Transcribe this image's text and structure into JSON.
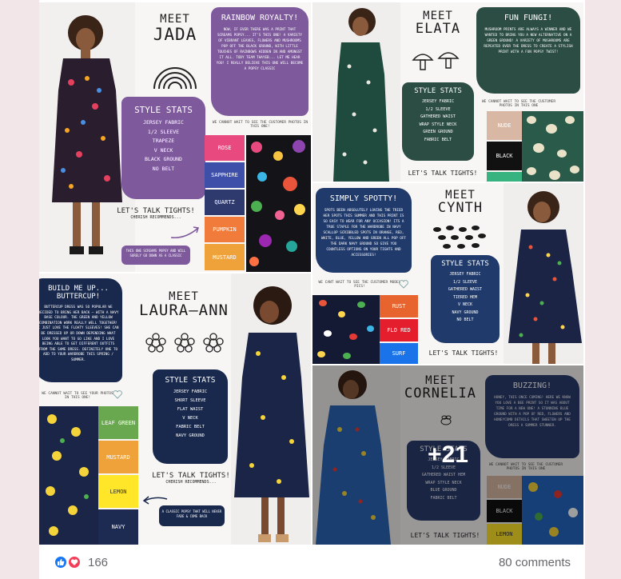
{
  "post": {
    "photo_count_overlay": "+21",
    "reactions": {
      "count": "166",
      "like_icon": "thumbs-up-icon",
      "love_icon": "heart-icon",
      "like_color": "#1877f2",
      "love_color": "#f33e58"
    },
    "comments_label": "80 comments"
  },
  "tiles": {
    "jada": {
      "meet": "MEET",
      "name": "JADA",
      "panel_title": "RAINBOW ROYALTY!",
      "panel_body": "NOW, IF EVER THERE WAS A PRINT THAT SCREAMS POPSY... IT'S THIS ONE! A VARIETY OF VIBRANT LEAVES, FLOWERS AND MUSHROOMS POP OFF THE BLACK GROUND, WITH LITTLE TOUCHES OF RAINBOWS HIDDEN IN AND AMONGST IT ALL. TODY TEAM THAYEB... LET ME HEAR YOU! I REALLY BELIEVE THIS ONE WILL BECOME A POPSY CLASSIC",
      "stats_title": "STYLE STATS",
      "stats": [
        "JERSEY FABRIC",
        "1/2 SLEEVE",
        "TRAPEZE",
        "V NECK",
        "BLACK GROUND",
        "NO BELT"
      ],
      "customer_caption": "WE CANNOT WAIT TO SEE THE CUSTOMER PHOTOS IN THIS ONE!",
      "tights_title": "LET'S TALK TIGHTS!",
      "tights_sub": "CHERISH RECOMMENDS...",
      "tights_note": "THIS ONE SCREAMS POPSY AND WILL SURELY GO DOWN AS A CLASSIC",
      "swatches": [
        "ROSE",
        "SAPPHIRE",
        "QUARTZ",
        "PUMPKIN",
        "MUSTARD"
      ],
      "panel_color": "#7e5a9c"
    },
    "elata": {
      "meet": "MEET",
      "name": "ELATA",
      "panel_title": "FUN FUNGI!",
      "panel_body": "MUSHROOM PRINTS ARE ALWAYS A WINNER AND WE WANTED TO BRING YOU A NEW ALTERNATIVE ON A GREEN GROUND! A VARIETY OF MUSHROOMS ARE REPEATED OVER THE DRESS TO CREATE A STYLISH PRINT WITH A FUN POPSY TWIST!",
      "stats_title": "STYLE STATS",
      "stats": [
        "JERSEY FABRIC",
        "1/2 SLEEVE",
        "GATHERED WAIST",
        "WRAP STYLE NECK",
        "GREEN GROUND",
        "FABRIC BELT"
      ],
      "customer_caption": "WE CANNOT WAIT TO SEE THE CUSTOMER PHOTOS IN THIS ONE",
      "tights_title": "LET'S TALK TIGHTS!",
      "swatches": [
        "NUDE",
        "BLACK"
      ],
      "panel_color": "#2c4d44"
    },
    "cynth": {
      "meet": "MEET",
      "name": "CYNTH",
      "panel_title": "SIMPLY SPOTTY!",
      "panel_body": "SPOTS BEEN ABSOLUTELY LOVING THE TRIED HER SPOTS THIS SUMMER AND THIS PRINT IS SO EASY TO WEAR FOR ANY OCCASION! ITS A TRUE STAPLE FOR THE WARDROBE IN NAVY SCALLOP SCRIBBLED SPOTS IN ORANGE, RED, WHITE, BLUE, YELLOW AND GREEN ALL POP OFF THE DARK NAVY GROUND SO GIVE YOU COUNTLESS OPTIONS ON YOUR TIGHTS AND ACCESSORIES!",
      "customer_caption": "WE CANT WAIT TO SEE THE CUSTOMER MODEL PICS!",
      "stats_title": "STYLE STATS",
      "stats": [
        "JERSEY FABRIC",
        "1/2 SLEEVE",
        "GATHERED WAIST",
        "TIERED HEM",
        "V NECK",
        "NAVY GROUND",
        "NO BELT"
      ],
      "tights_title": "LET'S TALK TIGHTS!",
      "swatches": [
        "RUST",
        "FLO RED",
        "SURF"
      ],
      "panel_color": "#1f3a6b"
    },
    "laura": {
      "meet": "MEET",
      "name": "LAURA—ANN",
      "panel_title": "BUILD ME UP... BUTTERCUP!",
      "panel_body": "BUTTERCUP DRESS WAS SO POPULAR WE DECIDED TO BRING HER BACK — WITH A NAVY BASE COLOUR. THE GREEN AND YELLOW COMBINATION WORK REALLY WELL TOGETHER! I JUST LOVE THE FLOATY SLEEVES! SHE CAN BE DRESSED UP OR DOWN DEPENDING WHAT LOOK YOU WANT TO GO LIKE AND I LOVE BEING ABLE TO GET DIFFERENT OUTFITS FROM THE SAME DRESS. DEFINITELY ONE TO ADD TO YOUR WARDROBE THIS SPRING / SUMMER.",
      "customer_caption": "WE CANNOT WAIT TO SEE YOUR PHOTOS IN THIS ONE!",
      "stats_title": "STYLE STATS",
      "stats": [
        "JERSEY FABRIC",
        "SHORT SLEEVE",
        "FLAT WAIST",
        "V NECK",
        "FABRIC BELT",
        "NAVY GROUND"
      ],
      "tights_title": "LET'S TALK TIGHTS!",
      "tights_sub": "CHERISH RECOMMENDS...",
      "tights_note": "A CLASSIC POPSY THAT WILL NEVER FADE & COME BACK",
      "swatches": [
        "LEAF GREEN",
        "MUSTARD",
        "LEMON",
        "NAVY"
      ],
      "panel_color": "#19294d"
    },
    "cornelia": {
      "meet": "MEET",
      "name": "CORNELIA",
      "panel_title": "BUZZING!",
      "panel_body": "HONEY, THIS ONCE COMING! HERE WE KNOW YOU LOVE A BEE PRINT SO IT WAS ABOUT TIME FOR A NEW ONE! A STUNNING BLUE GROUND WITH A POP OF RED, FLOWERS AND HONEYCOMB DETAILS THAT SWEETEN UP THE DRESS A SUMMER STUNNER.",
      "stats_title": "STYLE STATS",
      "stats": [
        "JERSEY FABRIC",
        "1/2 SLEEVE",
        "GATHERED WAIST HEM",
        "WRAP STYLE NECK",
        "BLUE GROUND",
        "FABRIC BELT"
      ],
      "customer_caption": "WE CANNOT WAIT TO SEE THE CUSTOMER PHOTOS IN THIS ONE",
      "tights_title": "LET'S TALK TIGHTS!",
      "swatches": [
        "NUDE",
        "BLACK",
        "LEMON"
      ],
      "panel_color": "#2b3c6e"
    }
  }
}
